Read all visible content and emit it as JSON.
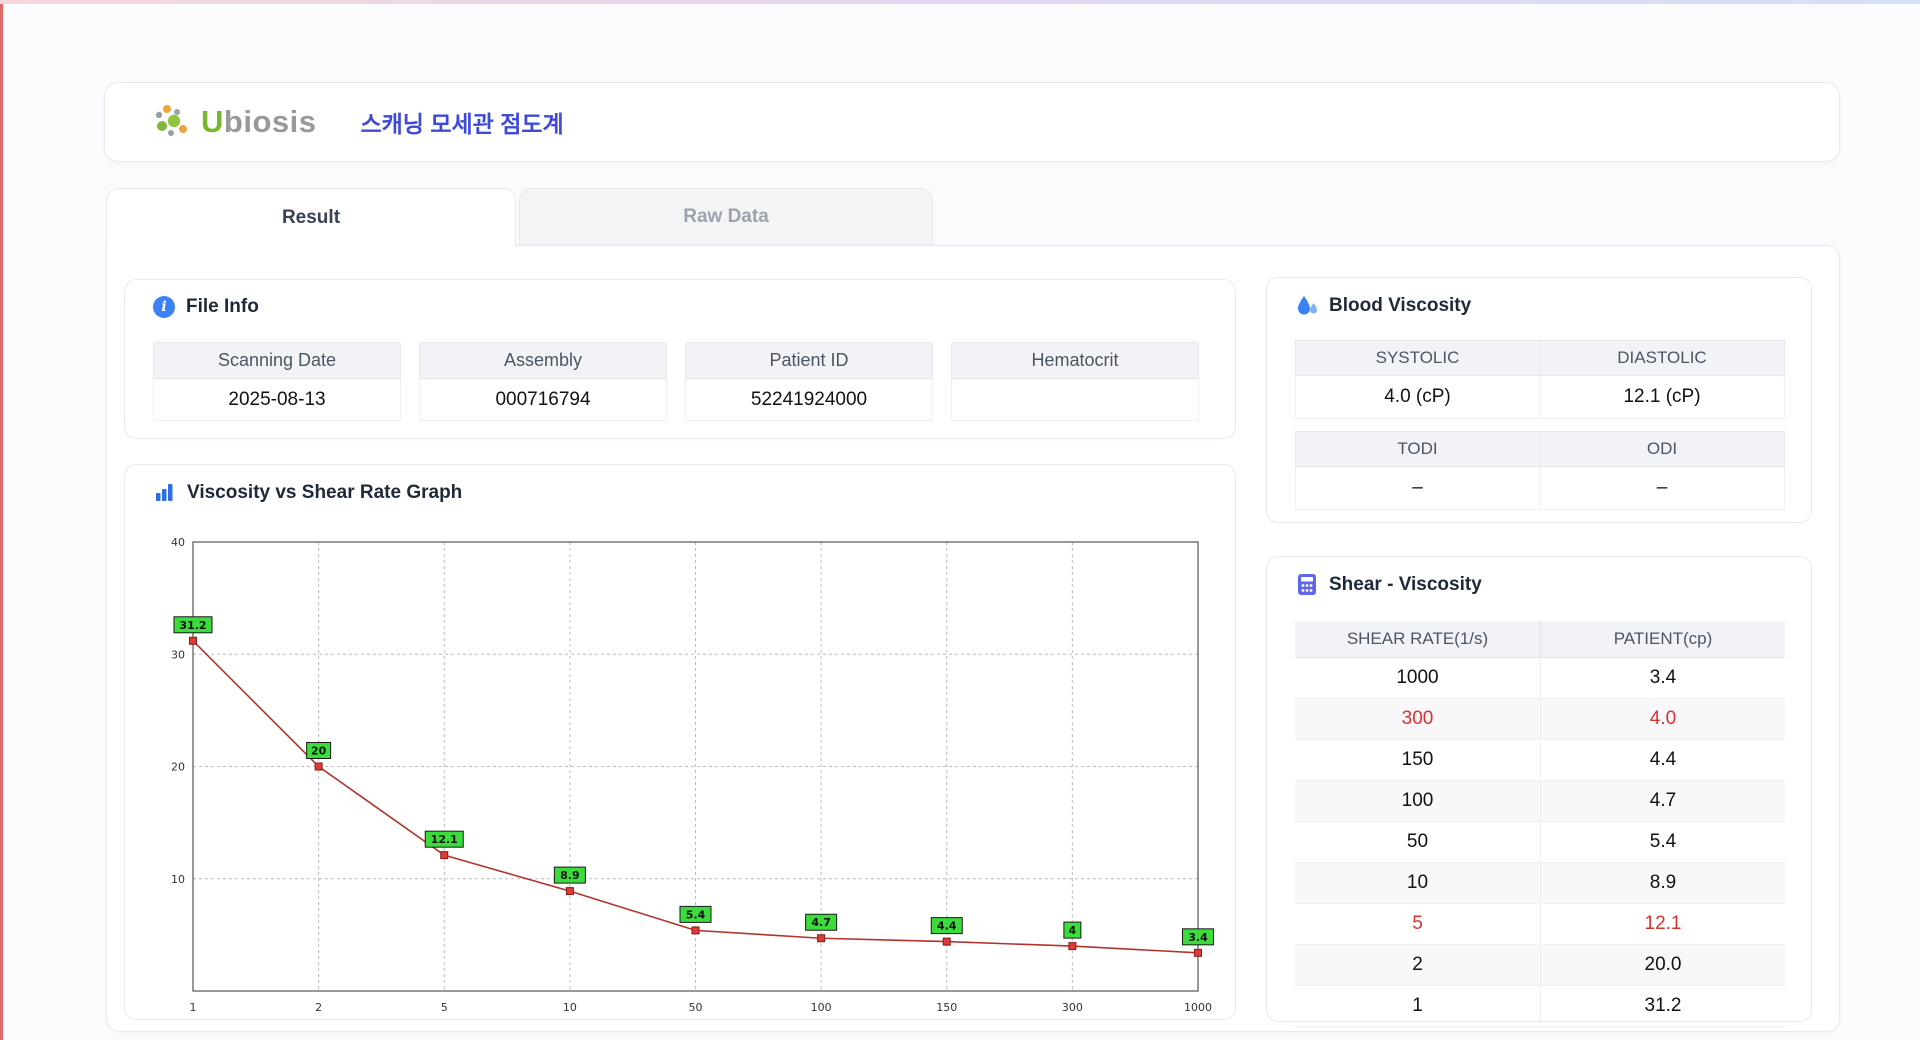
{
  "colors": {
    "brand_blue": "#3f4bd8",
    "logo_green": "#79b72e",
    "logo_gray": "#97999c",
    "accent_red": "#d93030",
    "chart_line": "#b2342e",
    "chart_marker": "#e03a36",
    "chart_label_bg": "#3bdc3b"
  },
  "header": {
    "logo_u": "U",
    "logo_rest": "biosis",
    "app_title": "스캐닝 모세관 점도계"
  },
  "tabs": [
    {
      "label": "Result",
      "active": true
    },
    {
      "label": "Raw Data",
      "active": false
    }
  ],
  "file_info": {
    "title": "File Info",
    "fields": [
      {
        "label": "Scanning Date",
        "value": "2025-08-13"
      },
      {
        "label": "Assembly",
        "value": "000716794"
      },
      {
        "label": "Patient ID",
        "value": "52241924000"
      },
      {
        "label": "Hematocrit",
        "value": ""
      }
    ]
  },
  "blood_viscosity": {
    "title": "Blood Viscosity",
    "pairs": [
      [
        {
          "label": "SYSTOLIC",
          "value": "4.0 (cP)"
        },
        {
          "label": "DIASTOLIC",
          "value": "12.1 (cP)"
        }
      ],
      [
        {
          "label": "TODI",
          "value": "–"
        },
        {
          "label": "ODI",
          "value": "–"
        }
      ]
    ]
  },
  "shear_table": {
    "title": "Shear - Viscosity",
    "columns": [
      "SHEAR RATE(1/s)",
      "PATIENT(cp)"
    ],
    "rows": [
      {
        "rate": "1000",
        "patient": "3.4",
        "highlight": false
      },
      {
        "rate": "300",
        "patient": "4.0",
        "highlight": true
      },
      {
        "rate": "150",
        "patient": "4.4",
        "highlight": false
      },
      {
        "rate": "100",
        "patient": "4.7",
        "highlight": false
      },
      {
        "rate": "50",
        "patient": "5.4",
        "highlight": false
      },
      {
        "rate": "10",
        "patient": "8.9",
        "highlight": false
      },
      {
        "rate": "5",
        "patient": "12.1",
        "highlight": true
      },
      {
        "rate": "2",
        "patient": "20.0",
        "highlight": false
      },
      {
        "rate": "1",
        "patient": "31.2",
        "highlight": false
      }
    ]
  },
  "chart_data": {
    "type": "line",
    "title": "Viscosity vs Shear Rate Graph",
    "x_categories": [
      "1",
      "2",
      "5",
      "10",
      "50",
      "100",
      "150",
      "300",
      "1000"
    ],
    "values": [
      31.2,
      20,
      12.1,
      8.9,
      5.4,
      4.7,
      4.4,
      4,
      3.4
    ],
    "point_labels": [
      "31.2",
      "20",
      "12.1",
      "8.9",
      "5.4",
      "4.7",
      "4.4",
      "4",
      "3.4"
    ],
    "y_ticks": [
      10,
      20,
      30,
      40
    ],
    "ylim": [
      0,
      40
    ],
    "xlabel": "",
    "ylabel": "",
    "grid": true,
    "legend": false
  }
}
